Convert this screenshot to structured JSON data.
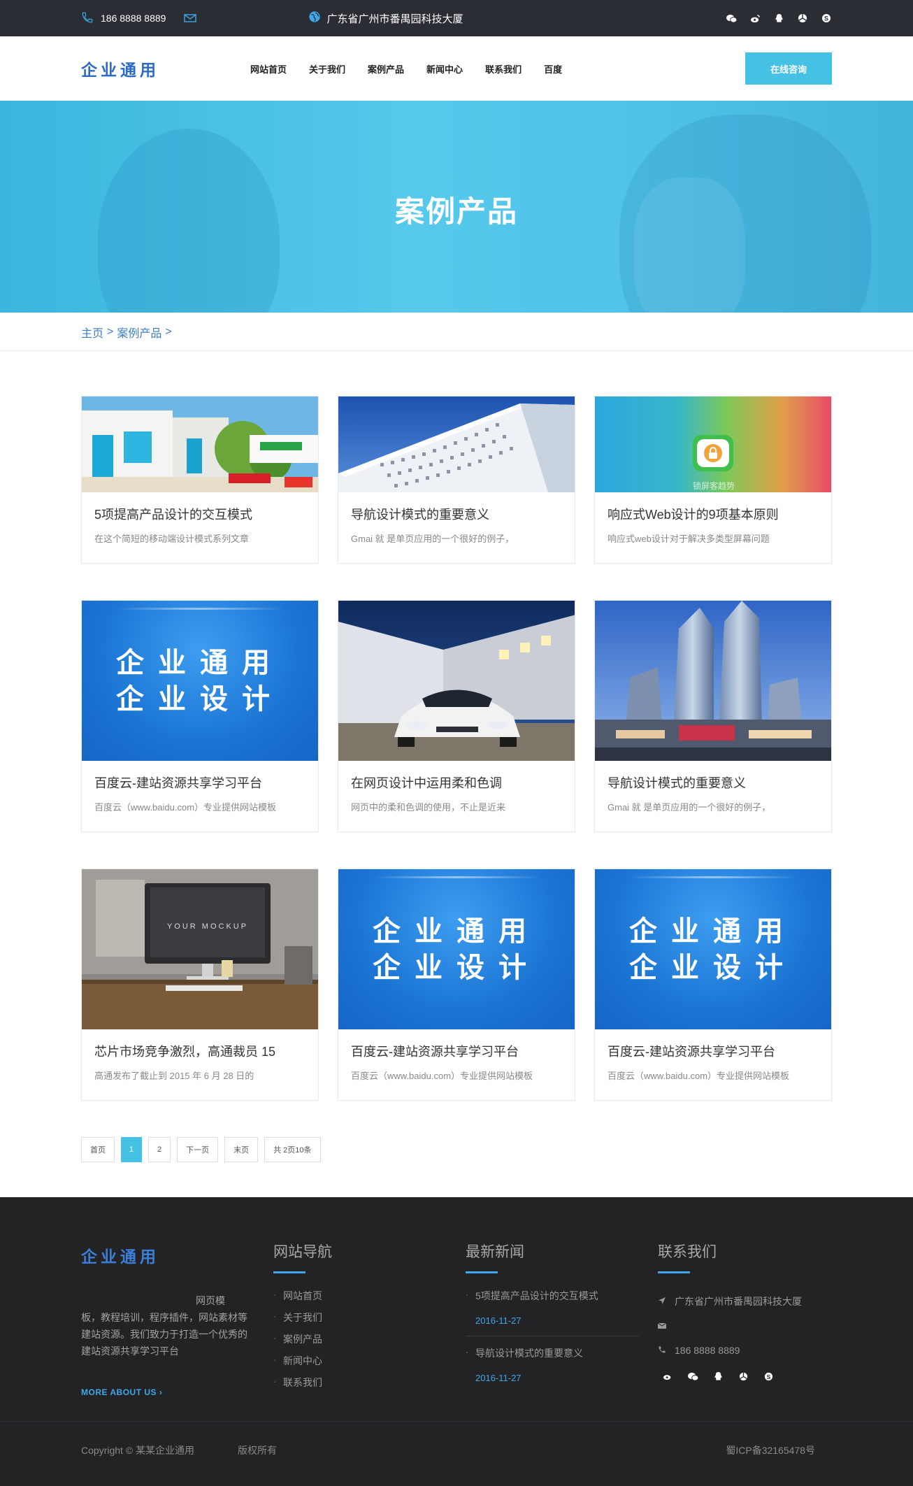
{
  "topbar": {
    "phone": "186 8888 8889",
    "address": "广东省广州市番禺园科技大厦",
    "social": [
      "wechat-icon",
      "weibo-icon",
      "qq-icon",
      "aperture-icon",
      "skype-icon"
    ]
  },
  "header": {
    "logo": "企业通用",
    "nav": [
      "网站首页",
      "关于我们",
      "案例产品",
      "新闻中心",
      "联系我们",
      "百度"
    ],
    "consult": "在线咨询"
  },
  "banner": {
    "title": "案例产品"
  },
  "breadcrumb": {
    "home": "主页",
    "sep": ">",
    "current": "案例产品",
    "sep2": ">"
  },
  "brand_image": {
    "line1": "企业通用",
    "line2": "企业设计"
  },
  "cards": [
    {
      "title": "5项提高产品设计的交互模式",
      "desc": "在这个简短的移动端设计模式系列文章"
    },
    {
      "title": "导航设计模式的重要意义",
      "desc": "Gmai 就 是单页应用的一个很好的例子，"
    },
    {
      "title": "响应式Web设计的9项基本原则",
      "desc": "响应式web设计对于解决多类型屏幕问题"
    },
    {
      "title": "百度云-建站资源共享学习平台",
      "desc": "百度云（www.baidu.com）专业提供网站模板"
    },
    {
      "title": "在网页设计中运用柔和色调",
      "desc": "网页中的柔和色调的使用，不止是近来"
    },
    {
      "title": "导航设计模式的重要意义",
      "desc": "Gmai 就 是单页应用的一个很好的例子，"
    },
    {
      "title": "芯片市场竞争激烈，高通裁员 15",
      "desc": "高通发布了截止到 2015 年 6 月 28 日的"
    },
    {
      "title": "百度云-建站资源共享学习平台",
      "desc": "百度云（www.baidu.com）专业提供网站模板"
    },
    {
      "title": "百度云-建站资源共享学习平台",
      "desc": "百度云（www.baidu.com）专业提供网站模板"
    }
  ],
  "thumb_text": {
    "lock_caption": "锁屏客趋势",
    "mockup": "YOUR MOCKUP"
  },
  "pagination": {
    "first": "首页",
    "p1": "1",
    "p2": "2",
    "next": "下一页",
    "last": "末页",
    "total": "共 2页10条"
  },
  "footer": {
    "logo": "企业通用",
    "about_line1": "网页模",
    "about_rest": "板，教程培训，程序插件，网站素材等建站资源。我们致力于打造一个优秀的建站资源共享学习平台",
    "more": "MORE ABOUT US",
    "nav_title": "网站导航",
    "nav_items": [
      "网站首页",
      "关于我们",
      "案例产品",
      "新闻中心",
      "联系我们"
    ],
    "news_title": "最新新闻",
    "news": [
      {
        "title": "5项提高产品设计的交互模式",
        "date": "2016-11-27"
      },
      {
        "title": "导航设计模式的重要意义",
        "date": "2016-11-27"
      }
    ],
    "contact_title": "联系我们",
    "contact_address": "广东省广州市番禺园科技大厦",
    "contact_phone": "186 8888 8889",
    "copyright": "Copyright © 某某企业通用",
    "rights": "版权所有",
    "icp": "蜀ICP备32165478号"
  },
  "colors": {
    "accent": "#45c1e6",
    "brand_blue": "#2c6bc4",
    "footer_bg": "#232326",
    "topbar_bg": "#2a2d33"
  }
}
